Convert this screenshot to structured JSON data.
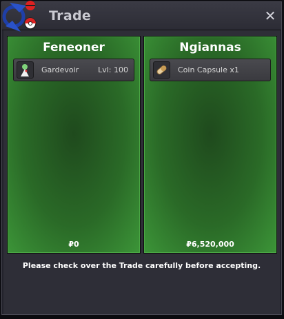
{
  "window": {
    "title": "Trade",
    "close_symbol": "✕",
    "logo_icon": "pokeball-arrows-icon"
  },
  "left_panel": {
    "player_name": "Feneoner",
    "item": {
      "icon": "gardevoir-sprite-icon",
      "name": "Gardevoir",
      "level": "Lvl: 100"
    },
    "money": "₽0"
  },
  "right_panel": {
    "player_name": "Ngiannas",
    "item": {
      "icon": "coin-capsule-icon",
      "name": "Coin Capsule",
      "quantity": "x1"
    },
    "money": "₽6,520,000"
  },
  "notice_text": "Please check over the Trade carefully before accepting.",
  "colors": {
    "panel_green": "#2a6a27",
    "panel_border": "#4aa844",
    "window_bg": "#23232c"
  }
}
